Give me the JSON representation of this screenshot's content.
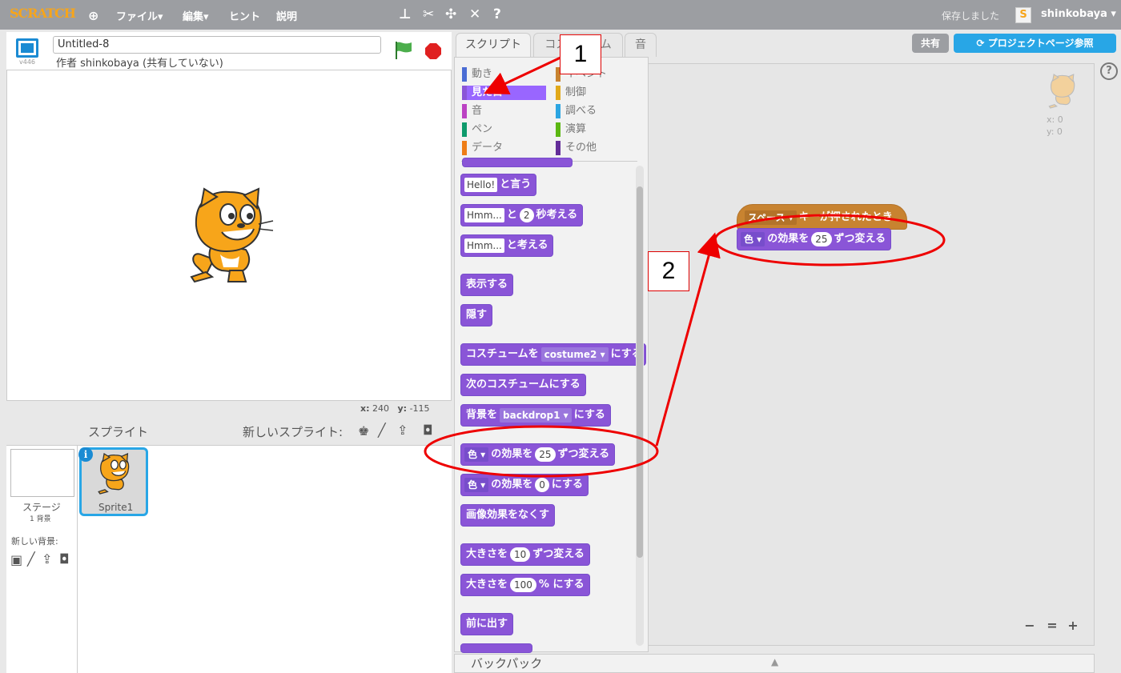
{
  "topbar": {
    "logo": "SCRATCH",
    "menu_file": "ファイル▾",
    "menu_edit": "編集▾",
    "menu_tips": "ヒント",
    "menu_about": "説明",
    "saved": "保存しました",
    "user_badge": "S",
    "username": "shinkobaya ▾"
  },
  "stage": {
    "version": "v446",
    "title": "Untitled-8",
    "author": "作者 shinkobaya (共有していない)",
    "x_label": "x:",
    "x_value": "240",
    "y_label": "y:",
    "y_value": "-115"
  },
  "sprites": {
    "title": "スプライト",
    "new_sprite": "新しいスプライト:",
    "stage_label": "ステージ",
    "stage_backdrops": "1 背景",
    "new_backdrop": "新しい背景:",
    "sprite1": "Sprite1",
    "info": "i"
  },
  "tabs": {
    "scripts": "スクリプト",
    "costumes": "コスチューム",
    "sounds": "音"
  },
  "buttons": {
    "share": "共有",
    "project_page": "プロジェクトページ参照"
  },
  "categories": {
    "motion": "動き",
    "looks": "見た目",
    "sound": "音",
    "pen": "ペン",
    "data": "データ",
    "events": "イベント",
    "control": "制御",
    "sensing": "調べる",
    "operators": "演算",
    "more": "その他"
  },
  "category_colors": {
    "motion": "#4a6cd4",
    "looks": "#8a55d7",
    "sound": "#bb42c3",
    "pen": "#0e9a6c",
    "data": "#ee7d16",
    "events": "#c88330",
    "control": "#e1a91a",
    "sensing": "#2ca5e2",
    "operators": "#5cb712",
    "more": "#632d99"
  },
  "blocks": {
    "say_slot": "Hello!",
    "say_text": "と言う",
    "say_secs_slot": "Hmm...",
    "say_secs_and": "と",
    "say_secs_num": "2",
    "say_secs_text": "秒考える",
    "think_slot": "Hmm...",
    "think_text": "と考える",
    "show": "表示する",
    "hide": "隠す",
    "switch_costume_text": "コスチュームを",
    "switch_costume_drop": "costume2 ▾",
    "switch_costume_tail": "にする",
    "next_costume": "次のコスチュームにする",
    "switch_backdrop_text": "背景を",
    "switch_backdrop_drop": "backdrop1 ▾",
    "switch_backdrop_tail": "にする",
    "change_effect_drop": "色 ▾",
    "change_effect_text": "の効果を",
    "change_effect_num": "25",
    "change_effect_tail": "ずつ変える",
    "set_effect_drop": "色 ▾",
    "set_effect_text": "の効果を",
    "set_effect_num": "0",
    "set_effect_tail": "にする",
    "clear_effects": "画像効果をなくす",
    "change_size_text": "大きさを",
    "change_size_num": "10",
    "change_size_tail": "ずつ変える",
    "set_size_text": "大きさを",
    "set_size_num": "100",
    "set_size_tail": "% にする",
    "front": "前に出す"
  },
  "script": {
    "hat_drop": "スペース ▾",
    "hat_text": "キーが押されたとき",
    "effect_drop": "色 ▾",
    "effect_text": "の効果を",
    "effect_num": "25",
    "effect_tail": "ずつ変える",
    "corner_x": "x: 0",
    "corner_y": "y: 0"
  },
  "zoom": {
    "out": "−",
    "reset": "=",
    "in": "+"
  },
  "help": "?",
  "backpack": "バックパック",
  "annotations": {
    "one": "1",
    "two": "2"
  }
}
